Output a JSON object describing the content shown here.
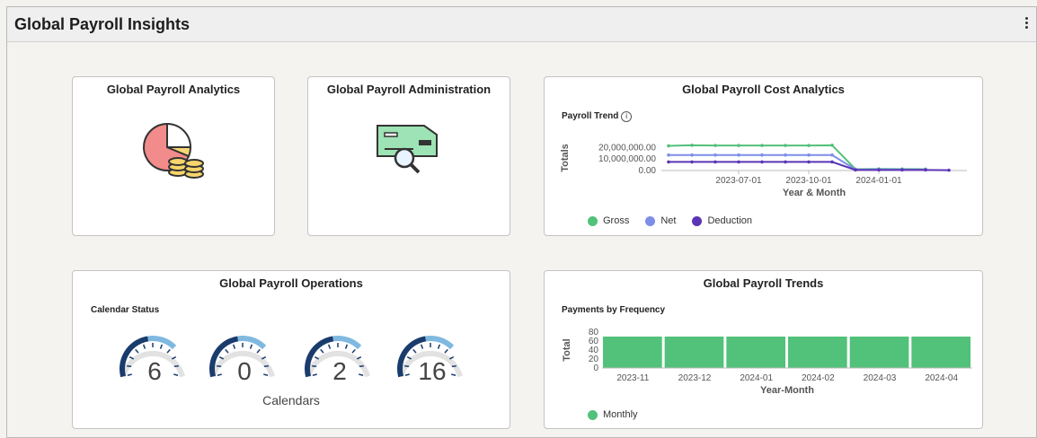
{
  "page": {
    "title": "Global Payroll Insights"
  },
  "colors": {
    "gross": "#52c17a",
    "net": "#7d8ee8",
    "deduction": "#5b35b5",
    "bar": "#52c17a",
    "gauge_dark": "#1a3c6d",
    "gauge_light": "#7fb9e0"
  },
  "tiles": {
    "analytics": {
      "title": "Global Payroll Analytics",
      "icon": "pie-coins-icon"
    },
    "administration": {
      "title": "Global Payroll Administration",
      "icon": "check-magnifier-icon"
    },
    "cost": {
      "title": "Global Payroll Cost Analytics",
      "subtitle": "Payroll Trend",
      "info_icon": "info-icon",
      "yaxis_title": "Totals",
      "xaxis_title": "Year & Month",
      "yticks": [
        "20,000,000.00",
        "10,000,000.00",
        "0.00"
      ],
      "xticks": [
        "2023-07-01",
        "2023-10-01",
        "2024-01-01"
      ],
      "legend": [
        "Gross",
        "Net",
        "Deduction"
      ]
    },
    "operations": {
      "title": "Global Payroll Operations",
      "subtitle": "Calendar Status",
      "gauges": [
        6,
        0,
        2,
        16
      ],
      "footer": "Calendars"
    },
    "trends": {
      "title": "Global Payroll Trends",
      "subtitle": "Payments by Frequency",
      "yaxis_title": "Total",
      "xaxis_title": "Year-Month",
      "yticks": [
        "80",
        "60",
        "40",
        "20",
        "0"
      ],
      "legend": [
        "Monthly"
      ]
    }
  },
  "chart_data": [
    {
      "type": "line",
      "title": "Payroll Trend",
      "xlabel": "Year & Month",
      "ylabel": "Totals",
      "x": [
        "2023-04-01",
        "2023-05-01",
        "2023-06-01",
        "2023-07-01",
        "2023-08-01",
        "2023-09-01",
        "2023-10-01",
        "2023-11-01",
        "2023-12-01",
        "2024-01-01",
        "2024-02-01",
        "2024-03-01",
        "2024-04-01"
      ],
      "ylim": [
        0,
        25000000
      ],
      "series": [
        {
          "name": "Gross",
          "values": [
            21500000,
            22000000,
            21800000,
            21800000,
            21800000,
            21800000,
            21800000,
            22000000,
            1200000,
            1400000,
            1300000,
            1200000,
            null
          ]
        },
        {
          "name": "Net",
          "values": [
            13500000,
            13500000,
            13500000,
            13500000,
            13500000,
            13500000,
            13500000,
            13500000,
            900000,
            1000000,
            900000,
            900000,
            null
          ]
        },
        {
          "name": "Deduction",
          "values": [
            7500000,
            7500000,
            7500000,
            7500000,
            7500000,
            7500000,
            7500000,
            7500000,
            500000,
            500000,
            500000,
            500000,
            300000
          ]
        }
      ]
    },
    {
      "type": "bar",
      "title": "Payments by Frequency",
      "xlabel": "Year-Month",
      "ylabel": "Total",
      "ylim": [
        0,
        80
      ],
      "categories": [
        "2023-11",
        "2023-12",
        "2024-01",
        "2024-02",
        "2024-03",
        "2024-04"
      ],
      "series": [
        {
          "name": "Monthly",
          "values": [
            70,
            70,
            70,
            70,
            70,
            70
          ]
        }
      ]
    }
  ]
}
